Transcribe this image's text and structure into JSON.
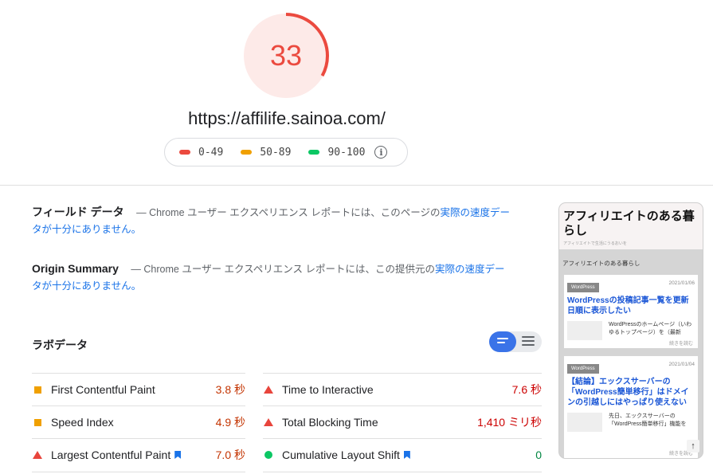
{
  "score": {
    "value": "33",
    "fraction": 0.33,
    "color": "#eb4a3f",
    "bg": "#fdeae8"
  },
  "url": "https://affilife.sainoa.com/",
  "legend": [
    {
      "label": "0-49",
      "color": "#eb4a3f"
    },
    {
      "label": "50-89",
      "color": "#f0a000"
    },
    {
      "label": "90-100",
      "color": "#0cc764"
    }
  ],
  "legend_info_icon": "info-icon",
  "field": {
    "title": "フィールド データ",
    "sep": "—",
    "text": "Chrome ユーザー エクスペリエンス レポートには、このページの",
    "link": "実際の速度データが十分にありません。"
  },
  "origin": {
    "title": "Origin Summary",
    "sep": "—",
    "text": "Chrome ユーザー エクスペリエンス レポートには、この提供元の",
    "link": "実際の速度データが十分にありません。"
  },
  "lab": {
    "title": "ラボデータ",
    "view_toggle_icons": [
      "summary-view-icon",
      "list-view-icon"
    ]
  },
  "metrics_left": [
    {
      "label": "First Contentful Paint",
      "value": "3.8 秒",
      "status": "average",
      "color": "#c33300"
    },
    {
      "label": "Speed Index",
      "value": "4.9 秒",
      "status": "average",
      "color": "#c33300"
    },
    {
      "label": "Largest Contentful Paint",
      "value": "7.0 秒",
      "status": "fail",
      "color": "#c33300",
      "bookmark": true
    }
  ],
  "metrics_right": [
    {
      "label": "Time to Interactive",
      "value": "7.6 秒",
      "status": "fail",
      "color": "#cc0000"
    },
    {
      "label": "Total Blocking Time",
      "value": "1,410 ミリ秒",
      "status": "fail",
      "color": "#cc0000"
    },
    {
      "label": "Cumulative Layout Shift",
      "value": "0",
      "status": "pass",
      "color": "#018642",
      "bookmark": true
    }
  ],
  "screenshot": {
    "site_title": "アフィリエイトのある暮らし",
    "site_sub": "アフィリエイトで生活にうるおいを",
    "breadcrumb": "アフィリエイトのある暮らし",
    "cards": [
      {
        "tag": "WordPress",
        "date": "2021/01/06",
        "title": "WordPressの投稿記事一覧を更新日順に表示したい",
        "body": "WordPressのホームページ（いわゆるトップページ）を（最新",
        "more": "続きを読む"
      },
      {
        "tag": "WordPress",
        "date": "2021/01/04",
        "title": "【結論】エックスサーバーの「WordPress簡単移行」はドメインの引越しにはやっぱり使えない",
        "body": "先日、エックスサーバーの「WordPress簡単移行」機能を",
        "more": "続きを読む"
      }
    ]
  }
}
